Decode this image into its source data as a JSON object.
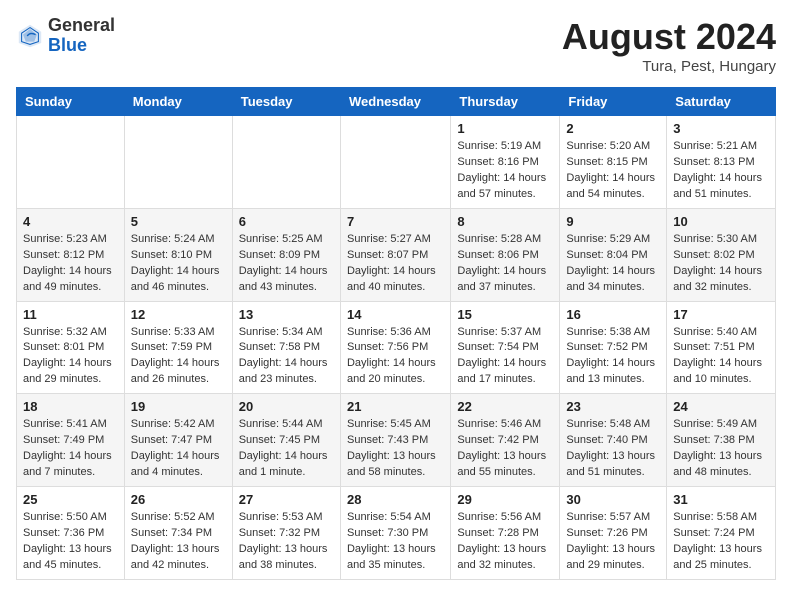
{
  "header": {
    "logo_general": "General",
    "logo_blue": "Blue",
    "month_year": "August 2024",
    "location": "Tura, Pest, Hungary"
  },
  "calendar": {
    "days_of_week": [
      "Sunday",
      "Monday",
      "Tuesday",
      "Wednesday",
      "Thursday",
      "Friday",
      "Saturday"
    ],
    "weeks": [
      {
        "days": [
          {
            "num": "",
            "info": ""
          },
          {
            "num": "",
            "info": ""
          },
          {
            "num": "",
            "info": ""
          },
          {
            "num": "",
            "info": ""
          },
          {
            "num": "1",
            "info": "Sunrise: 5:19 AM\nSunset: 8:16 PM\nDaylight: 14 hours\nand 57 minutes."
          },
          {
            "num": "2",
            "info": "Sunrise: 5:20 AM\nSunset: 8:15 PM\nDaylight: 14 hours\nand 54 minutes."
          },
          {
            "num": "3",
            "info": "Sunrise: 5:21 AM\nSunset: 8:13 PM\nDaylight: 14 hours\nand 51 minutes."
          }
        ]
      },
      {
        "days": [
          {
            "num": "4",
            "info": "Sunrise: 5:23 AM\nSunset: 8:12 PM\nDaylight: 14 hours\nand 49 minutes."
          },
          {
            "num": "5",
            "info": "Sunrise: 5:24 AM\nSunset: 8:10 PM\nDaylight: 14 hours\nand 46 minutes."
          },
          {
            "num": "6",
            "info": "Sunrise: 5:25 AM\nSunset: 8:09 PM\nDaylight: 14 hours\nand 43 minutes."
          },
          {
            "num": "7",
            "info": "Sunrise: 5:27 AM\nSunset: 8:07 PM\nDaylight: 14 hours\nand 40 minutes."
          },
          {
            "num": "8",
            "info": "Sunrise: 5:28 AM\nSunset: 8:06 PM\nDaylight: 14 hours\nand 37 minutes."
          },
          {
            "num": "9",
            "info": "Sunrise: 5:29 AM\nSunset: 8:04 PM\nDaylight: 14 hours\nand 34 minutes."
          },
          {
            "num": "10",
            "info": "Sunrise: 5:30 AM\nSunset: 8:02 PM\nDaylight: 14 hours\nand 32 minutes."
          }
        ]
      },
      {
        "days": [
          {
            "num": "11",
            "info": "Sunrise: 5:32 AM\nSunset: 8:01 PM\nDaylight: 14 hours\nand 29 minutes."
          },
          {
            "num": "12",
            "info": "Sunrise: 5:33 AM\nSunset: 7:59 PM\nDaylight: 14 hours\nand 26 minutes."
          },
          {
            "num": "13",
            "info": "Sunrise: 5:34 AM\nSunset: 7:58 PM\nDaylight: 14 hours\nand 23 minutes."
          },
          {
            "num": "14",
            "info": "Sunrise: 5:36 AM\nSunset: 7:56 PM\nDaylight: 14 hours\nand 20 minutes."
          },
          {
            "num": "15",
            "info": "Sunrise: 5:37 AM\nSunset: 7:54 PM\nDaylight: 14 hours\nand 17 minutes."
          },
          {
            "num": "16",
            "info": "Sunrise: 5:38 AM\nSunset: 7:52 PM\nDaylight: 14 hours\nand 13 minutes."
          },
          {
            "num": "17",
            "info": "Sunrise: 5:40 AM\nSunset: 7:51 PM\nDaylight: 14 hours\nand 10 minutes."
          }
        ]
      },
      {
        "days": [
          {
            "num": "18",
            "info": "Sunrise: 5:41 AM\nSunset: 7:49 PM\nDaylight: 14 hours\nand 7 minutes."
          },
          {
            "num": "19",
            "info": "Sunrise: 5:42 AM\nSunset: 7:47 PM\nDaylight: 14 hours\nand 4 minutes."
          },
          {
            "num": "20",
            "info": "Sunrise: 5:44 AM\nSunset: 7:45 PM\nDaylight: 14 hours\nand 1 minute."
          },
          {
            "num": "21",
            "info": "Sunrise: 5:45 AM\nSunset: 7:43 PM\nDaylight: 13 hours\nand 58 minutes."
          },
          {
            "num": "22",
            "info": "Sunrise: 5:46 AM\nSunset: 7:42 PM\nDaylight: 13 hours\nand 55 minutes."
          },
          {
            "num": "23",
            "info": "Sunrise: 5:48 AM\nSunset: 7:40 PM\nDaylight: 13 hours\nand 51 minutes."
          },
          {
            "num": "24",
            "info": "Sunrise: 5:49 AM\nSunset: 7:38 PM\nDaylight: 13 hours\nand 48 minutes."
          }
        ]
      },
      {
        "days": [
          {
            "num": "25",
            "info": "Sunrise: 5:50 AM\nSunset: 7:36 PM\nDaylight: 13 hours\nand 45 minutes."
          },
          {
            "num": "26",
            "info": "Sunrise: 5:52 AM\nSunset: 7:34 PM\nDaylight: 13 hours\nand 42 minutes."
          },
          {
            "num": "27",
            "info": "Sunrise: 5:53 AM\nSunset: 7:32 PM\nDaylight: 13 hours\nand 38 minutes."
          },
          {
            "num": "28",
            "info": "Sunrise: 5:54 AM\nSunset: 7:30 PM\nDaylight: 13 hours\nand 35 minutes."
          },
          {
            "num": "29",
            "info": "Sunrise: 5:56 AM\nSunset: 7:28 PM\nDaylight: 13 hours\nand 32 minutes."
          },
          {
            "num": "30",
            "info": "Sunrise: 5:57 AM\nSunset: 7:26 PM\nDaylight: 13 hours\nand 29 minutes."
          },
          {
            "num": "31",
            "info": "Sunrise: 5:58 AM\nSunset: 7:24 PM\nDaylight: 13 hours\nand 25 minutes."
          }
        ]
      }
    ]
  }
}
